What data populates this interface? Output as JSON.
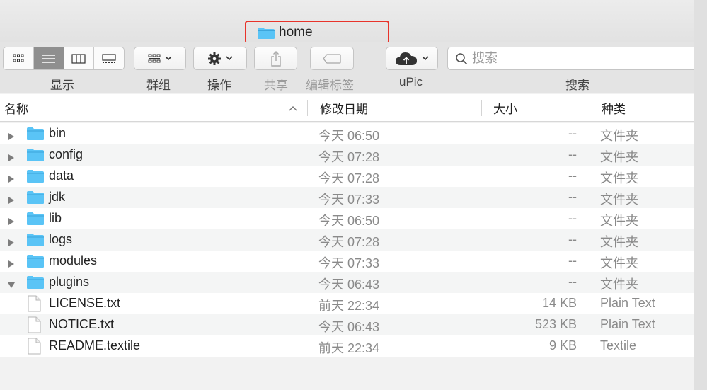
{
  "window": {
    "title": "home"
  },
  "toolbar": {
    "view_label": "显示",
    "view_modes": [
      "icon-view",
      "list-view",
      "column-view",
      "gallery-view"
    ],
    "active_view": "list-view",
    "group_label": "群组",
    "action_label": "操作",
    "share_label": "共享",
    "tags_label": "编辑标签",
    "upic_label": "uPic",
    "search_label": "搜索",
    "search_placeholder": "搜索"
  },
  "columns": {
    "name": "名称",
    "modified": "修改日期",
    "size": "大小",
    "kind": "种类"
  },
  "files": [
    {
      "name": "bin",
      "type": "folder",
      "expanded": false,
      "modified": "今天 06:50",
      "size": "--",
      "kind": "文件夹"
    },
    {
      "name": "config",
      "type": "folder",
      "expanded": false,
      "modified": "今天 07:28",
      "size": "--",
      "kind": "文件夹"
    },
    {
      "name": "data",
      "type": "folder",
      "expanded": false,
      "modified": "今天 07:28",
      "size": "--",
      "kind": "文件夹"
    },
    {
      "name": "jdk",
      "type": "folder",
      "expanded": false,
      "modified": "今天 07:33",
      "size": "--",
      "kind": "文件夹"
    },
    {
      "name": "lib",
      "type": "folder",
      "expanded": false,
      "modified": "今天 06:50",
      "size": "--",
      "kind": "文件夹"
    },
    {
      "name": "logs",
      "type": "folder",
      "expanded": false,
      "modified": "今天 07:28",
      "size": "--",
      "kind": "文件夹"
    },
    {
      "name": "modules",
      "type": "folder",
      "expanded": false,
      "modified": "今天 07:33",
      "size": "--",
      "kind": "文件夹"
    },
    {
      "name": "plugins",
      "type": "folder",
      "expanded": true,
      "modified": "今天 06:43",
      "size": "--",
      "kind": "文件夹"
    },
    {
      "name": "LICENSE.txt",
      "type": "file",
      "modified": "前天 22:34",
      "size": "14 KB",
      "kind": "Plain Text"
    },
    {
      "name": "NOTICE.txt",
      "type": "file",
      "modified": "今天 06:43",
      "size": "523 KB",
      "kind": "Plain Text"
    },
    {
      "name": "README.textile",
      "type": "file",
      "modified": "前天 22:34",
      "size": "9 KB",
      "kind": "Textile"
    }
  ],
  "colors": {
    "folder": "#5ac4f6",
    "highlight_border": "#e8342b",
    "row_alt": "#f4f5f5"
  }
}
